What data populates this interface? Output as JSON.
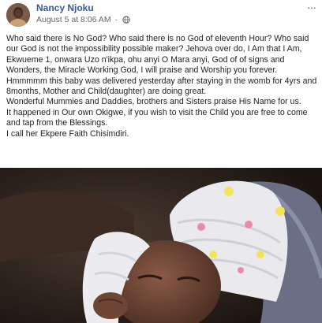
{
  "post": {
    "author": "Nancy Njoku",
    "timestamp": "August 5 at 8:06 AM",
    "separator": "·",
    "more_label": "···",
    "paragraphs": [
      "Who said there is No God? Who said there is no God of eleventh Hour? Who said our God is not the impossibility possible maker? Jehova over do, I Am that I Am, Ekwueme 1, onwara Uzo n'ikpa, ohu anyi O Mara anyi, God of of signs and Wonders, the Miracle Working God, I will praise and Worship you forever.",
      "Hmmmmm this baby was delivered yesterday after staying in the womb for 4yrs and 8months, Mother and Child(daughter) are doing great.",
      "Wonderful Mummies and Daddies, brothers and Sisters praise His Name for us.",
      "It happened in Our own Okigwe, if you wish to visit the Child you are free to come and tap from the Blessings.",
      "I call her Ekpere Faith Chisimdiri."
    ]
  },
  "icons": {
    "privacy": "globe-icon",
    "menu": "more-options-icon",
    "profile": "avatar"
  },
  "colors": {
    "author_link": "#385898",
    "meta_text": "#606770",
    "body_text": "#1c1e21"
  }
}
